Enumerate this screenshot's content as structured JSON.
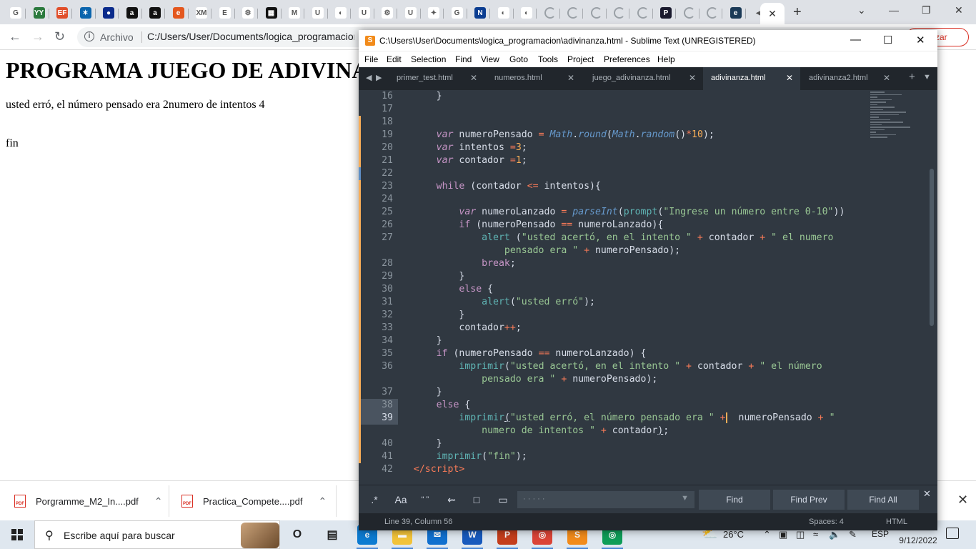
{
  "browser": {
    "tab_icons": [
      "google-icon",
      "yy-icon",
      "ef-icon",
      "azure-icon",
      "eu-icon",
      "amazon-icon",
      "amazon-icon",
      "edge-e-icon",
      "xm-icon",
      "ep-icon",
      "settings-icon",
      "qr-icon",
      "m-icon",
      "u-icon",
      "globe-icon",
      "u-icon",
      "gear-icon",
      "u-icon",
      "twitter-icon",
      "google-icon",
      "nasa-icon",
      "planet-icon",
      "planet-icon",
      "loading-icon",
      "loading-icon",
      "loading-icon",
      "loading-icon",
      "loading-icon",
      "pd-icon",
      "loading-icon",
      "loading-icon",
      "dark-e-icon",
      "audio-icon"
    ],
    "tab_letters": [
      "G",
      "YY",
      "EF",
      "✶",
      "●",
      "a",
      "a",
      "e",
      "XM",
      "E",
      "⚙",
      "▦",
      "M",
      "U",
      "◐",
      "U",
      "⚙",
      "U",
      "✦",
      "G",
      "N",
      "◐",
      "◐",
      "",
      "",
      "",
      "",
      "",
      "P",
      "",
      "",
      "e",
      "◀"
    ],
    "tab_colors": [
      "#fff",
      "#2b7a3d",
      "#e14f2b",
      "#0a64ad",
      "#0b2b8c",
      "#111",
      "#111",
      "#e4571e",
      "#fff",
      "#fff",
      "#fff",
      "#111",
      "#fff",
      "#fff",
      "#fff",
      "#fff",
      "#fff",
      "#fff",
      "#fff",
      "#fff",
      "#0b3d91",
      "#fff",
      "#fff",
      "#fff",
      "#fff",
      "#fff",
      "#fff",
      "#fff",
      "#1a1a2e",
      "#fff",
      "#fff",
      "#1b3a57",
      "#dee1e6"
    ],
    "active_tab_close": "✕",
    "new_tab": "+",
    "address": {
      "scheme_label": "Archivo",
      "url": "C:/Users/User/Documents/logica_programacion/adivinanza.html",
      "action_label": "zar"
    }
  },
  "page": {
    "heading": "PROGRAMA JUEGO DE ADIVINANZA",
    "line1": "usted erró, el número pensado era 2numero de intentos 4",
    "line2": "fin"
  },
  "downloads": [
    {
      "name": "Porgramme_M2_In....pdf",
      "badge": "PDF"
    },
    {
      "name": "Practica_Compete....pdf",
      "badge": "PDF"
    }
  ],
  "taskbar": {
    "search_placeholder": "Escribe aquí para buscar",
    "temperature": "26°C",
    "language": "ESP",
    "time": "20:35",
    "date": "9/12/2022",
    "apps": [
      {
        "name": "cortana-icon",
        "label": "O",
        "color": "#dfe7ef"
      },
      {
        "name": "task-view-icon",
        "label": "▤",
        "color": "#dfe7ef"
      },
      {
        "name": "edge-icon",
        "label": "e",
        "color": "#0c7bd1"
      },
      {
        "name": "file-explorer-icon",
        "label": "▬",
        "color": "#f2c33a"
      },
      {
        "name": "mail-icon",
        "label": "✉",
        "color": "#1170cf"
      },
      {
        "name": "word-icon",
        "label": "W",
        "color": "#185abd"
      },
      {
        "name": "powerpoint-icon",
        "label": "P",
        "color": "#c43e1c"
      },
      {
        "name": "chrome-icon",
        "label": "◎",
        "color": "#db4437"
      },
      {
        "name": "sublime-icon",
        "label": "S",
        "color": "#f28b1a"
      },
      {
        "name": "chrome-alt-icon",
        "label": "◎",
        "color": "#0f9d58"
      }
    ]
  },
  "sublime": {
    "title": "C:\\Users\\User\\Documents\\logica_programacion\\adivinanza.html - Sublime Text (UNREGISTERED)",
    "menu": [
      "File",
      "Edit",
      "Selection",
      "Find",
      "View",
      "Goto",
      "Tools",
      "Project",
      "Preferences",
      "Help"
    ],
    "tabs": [
      {
        "label": "primer_test.html",
        "active": false
      },
      {
        "label": "numeros.html",
        "active": false
      },
      {
        "label": "juego_adivinanza.html",
        "active": false
      },
      {
        "label": "adivinanza.html",
        "active": true
      },
      {
        "label": "adivinanza2.html",
        "active": false
      }
    ],
    "line_numbers": [
      "16",
      "17",
      "18",
      "19",
      "20",
      "21",
      "22",
      "23",
      "24",
      "25",
      "26",
      "27",
      "",
      "28",
      "29",
      "30",
      "31",
      "32",
      "33",
      "34",
      "35",
      "36",
      "",
      "37",
      "38",
      "39",
      "",
      "40",
      "41",
      "42"
    ],
    "find": {
      "regex": ".*",
      "case": "Aa",
      "word": "“ ”",
      "wrap": "⇜",
      "in_selection": "□",
      "highlight": "▭",
      "placeholder": "· · · · ·",
      "find": "Find",
      "find_prev": "Find Prev",
      "find_all": "Find All",
      "close": "✕"
    },
    "status": {
      "position": "Line 39, Column 56",
      "spaces": "Spaces: 4",
      "syntax": "HTML"
    }
  }
}
